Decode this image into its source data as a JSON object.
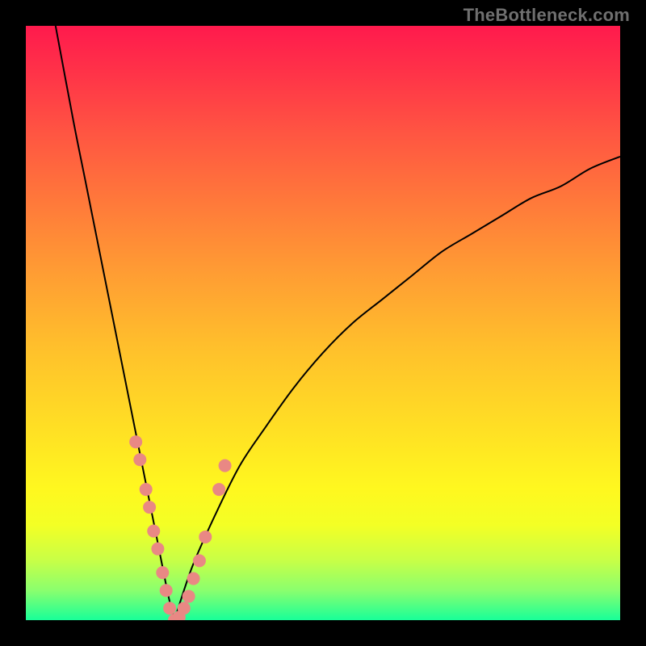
{
  "watermark": "TheBottleneck.com",
  "chart_data": {
    "type": "line",
    "title": "",
    "xlabel": "",
    "ylabel": "",
    "xlim": [
      0,
      100
    ],
    "ylim": [
      0,
      100
    ],
    "minimum_x": 25,
    "description": "Two smooth curves forming a V. Left branch drops steeply from x≈5,y=100 to near (25,0). Right branch rises with decreasing slope from (25,0) toward about (100,78). Pink markers cluster near the bottom of the V, roughly x∈[18,34], y∈[0,30].",
    "series": [
      {
        "name": "left_branch",
        "x": [
          5,
          8,
          10,
          12,
          14,
          16,
          18,
          20,
          22,
          24,
          25
        ],
        "y": [
          100,
          84,
          74,
          64,
          54,
          44,
          34,
          24,
          14,
          4,
          0
        ]
      },
      {
        "name": "right_branch",
        "x": [
          25,
          28,
          32,
          36,
          40,
          45,
          50,
          55,
          60,
          65,
          70,
          75,
          80,
          85,
          90,
          95,
          100
        ],
        "y": [
          0,
          9,
          18,
          26,
          32,
          39,
          45,
          50,
          54,
          58,
          62,
          65,
          68,
          71,
          73,
          76,
          78
        ]
      }
    ],
    "markers": [
      {
        "x": 18.5,
        "y": 30
      },
      {
        "x": 19.2,
        "y": 27
      },
      {
        "x": 20.2,
        "y": 22
      },
      {
        "x": 20.8,
        "y": 19
      },
      {
        "x": 21.5,
        "y": 15
      },
      {
        "x": 22.2,
        "y": 12
      },
      {
        "x": 23.0,
        "y": 8
      },
      {
        "x": 23.6,
        "y": 5
      },
      {
        "x": 24.2,
        "y": 2
      },
      {
        "x": 25.0,
        "y": 0
      },
      {
        "x": 25.8,
        "y": 0.5
      },
      {
        "x": 26.6,
        "y": 2
      },
      {
        "x": 27.4,
        "y": 4
      },
      {
        "x": 28.2,
        "y": 7
      },
      {
        "x": 29.2,
        "y": 10
      },
      {
        "x": 30.2,
        "y": 14
      },
      {
        "x": 32.5,
        "y": 22
      },
      {
        "x": 33.5,
        "y": 26
      }
    ],
    "marker_color": "#e98884",
    "background_gradient": [
      "#ff1a4d",
      "#ff9e33",
      "#fff81f",
      "#18ff99"
    ]
  }
}
